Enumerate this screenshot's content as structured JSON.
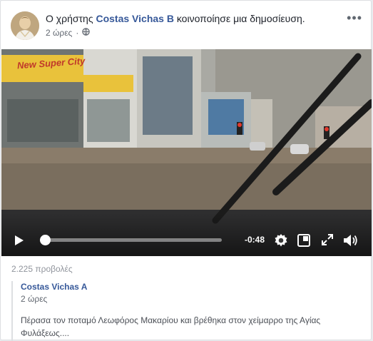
{
  "post": {
    "prefix": "Ο χρήστης",
    "author": "Costas Vichas B",
    "suffix": "κοινοποίησε μια δημοσίευση.",
    "time": "2 ώρες",
    "audience_icon": "globe-icon",
    "menu_icon": "more-options-icon"
  },
  "video": {
    "shop_sign": "New Super City",
    "time_remaining": "-0:48",
    "progress": 0.0,
    "icons": [
      "play-icon",
      "settings-icon",
      "picture-in-picture-icon",
      "fullscreen-icon",
      "volume-icon"
    ]
  },
  "stats": {
    "views": "2.225 προβολές"
  },
  "shared": {
    "author": "Costas Vichas A",
    "time": "2 ώρες",
    "text": "Πέρασα τον ποταμό Λεωφόρος Μακαρίου και βρέθηκα στον χείμαρρο της Αγίας Φυλάξεως...."
  },
  "colors": {
    "link": "#365899",
    "meta": "#616770",
    "card_border": "#dddfe2"
  }
}
